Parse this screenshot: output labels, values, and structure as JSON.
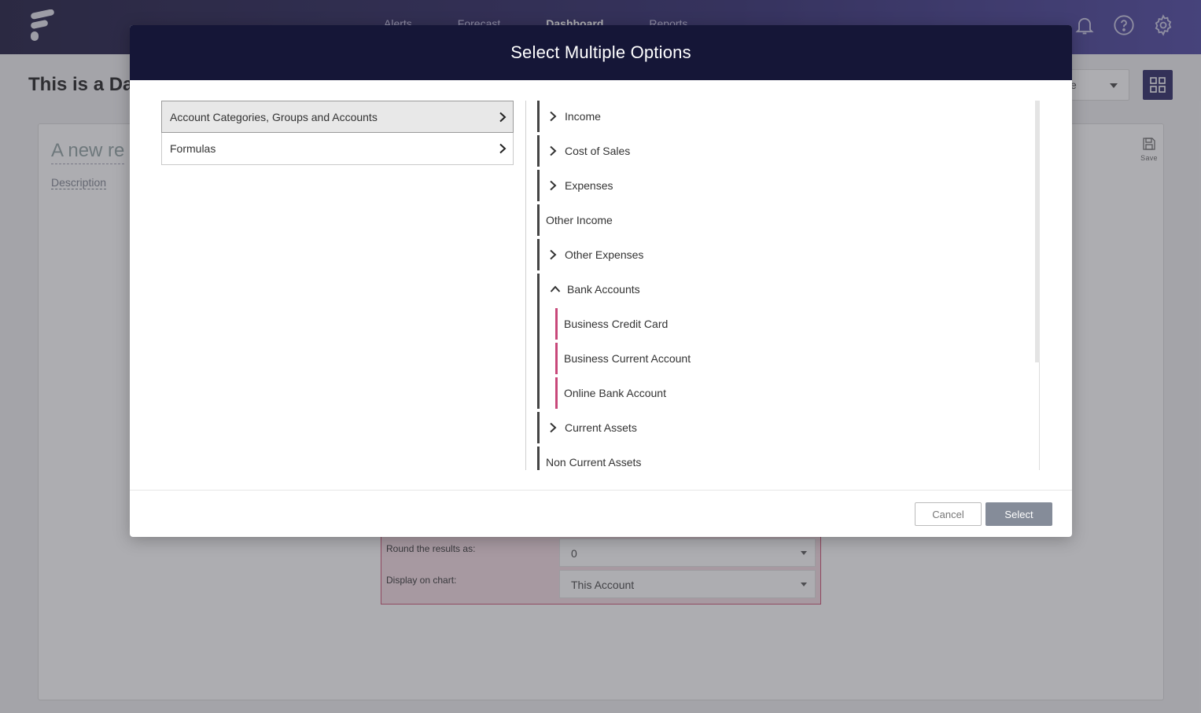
{
  "app": {
    "nav": [
      "Alerts",
      "Forecast",
      "Dashboard",
      "Reports"
    ],
    "active_nav": "Dashboard",
    "page_title": "This is a Das",
    "view_select": "e",
    "card": {
      "title": "A new re",
      "description": "Description",
      "save_label": "Save"
    },
    "config": {
      "round_label": "Round the results as:",
      "round_value": "0",
      "display_label": "Display on chart:",
      "display_value": "This Account"
    }
  },
  "modal": {
    "title": "Select Multiple Options",
    "left_items": [
      {
        "label": "Account Categories, Groups and Accounts",
        "selected": true
      },
      {
        "label": "Formulas",
        "selected": false
      }
    ],
    "tree": {
      "income": "Income",
      "cost_of_sales": "Cost of Sales",
      "expenses": "Expenses",
      "other_income": "Other Income",
      "other_expenses": "Other Expenses",
      "bank_accounts": "Bank Accounts",
      "bank_children": [
        "Business Credit Card",
        "Business Current Account",
        "Online Bank Account"
      ],
      "current_assets": "Current Assets",
      "non_current_assets": "Non Current Assets"
    },
    "cancel_label": "Cancel",
    "select_label": "Select"
  },
  "icons": {
    "logo": "fathom-logo",
    "bell": "bell-icon",
    "help": "help-icon",
    "gear": "gear-icon",
    "grid": "grid-icon",
    "save": "save-icon",
    "chevron_right": "chevron-right-icon",
    "chevron_up": "chevron-up-icon"
  },
  "colors": {
    "header_dark": "#151637",
    "accent_child": "#c8487a",
    "select_button": "#858c99"
  }
}
